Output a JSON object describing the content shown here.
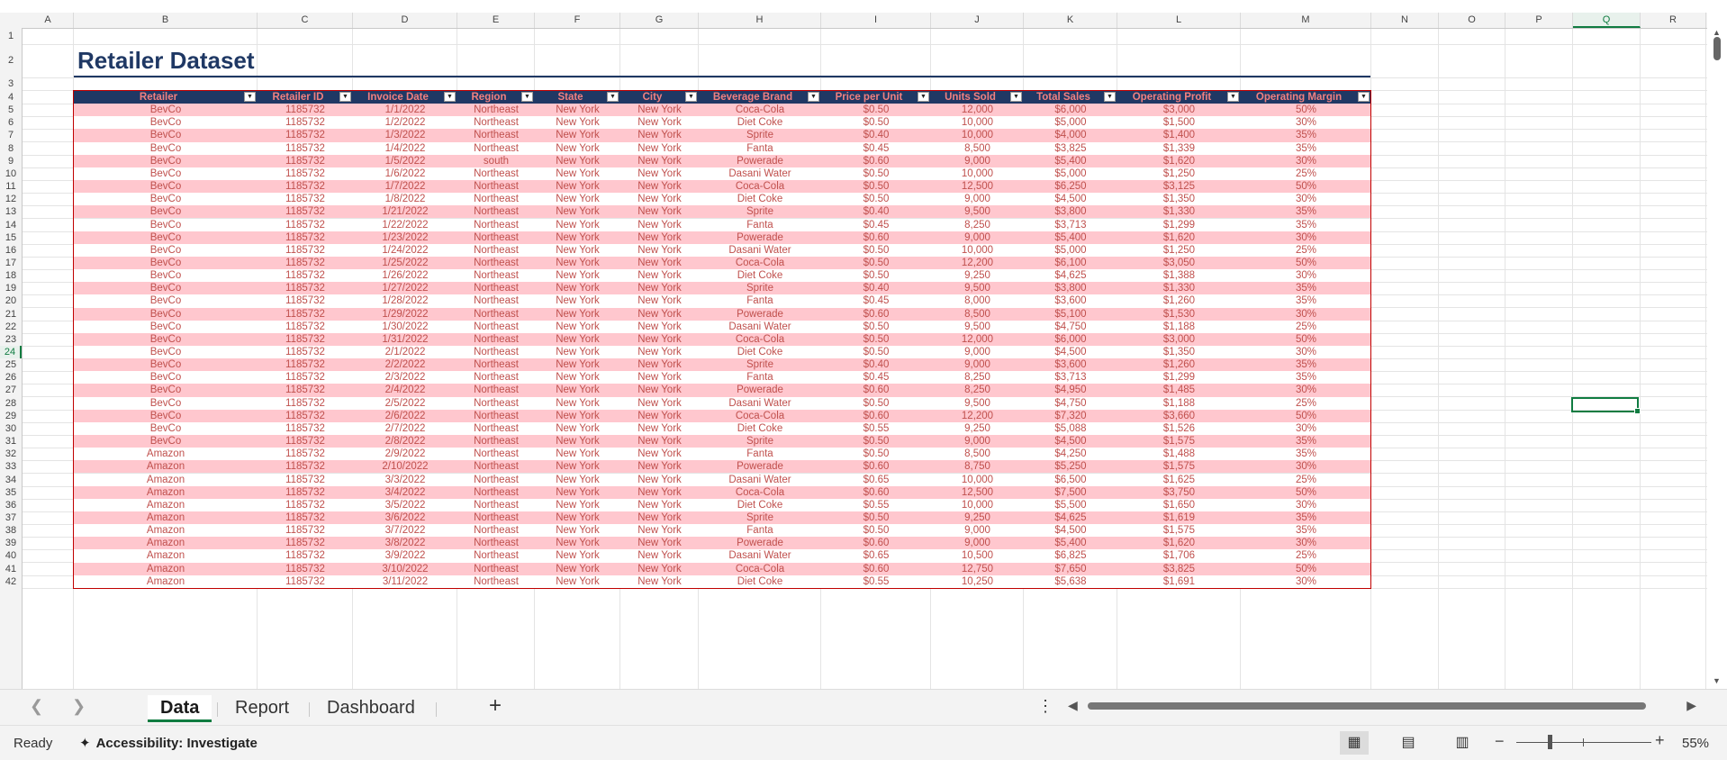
{
  "columns": [
    "A",
    "B",
    "C",
    "D",
    "E",
    "F",
    "G",
    "H",
    "I",
    "J",
    "K",
    "L",
    "M",
    "N",
    "O",
    "P",
    "Q",
    "R"
  ],
  "active_column": "Q",
  "rows": [
    "1",
    "2",
    "3",
    "4",
    "5",
    "6",
    "7",
    "8",
    "9",
    "10",
    "11",
    "12",
    "13",
    "14",
    "15",
    "16",
    "17",
    "18",
    "19",
    "20",
    "21",
    "22",
    "23",
    "24",
    "25",
    "26",
    "27",
    "28",
    "29",
    "30",
    "31",
    "32",
    "33",
    "34",
    "35",
    "36",
    "37",
    "38",
    "39",
    "40",
    "41",
    "42"
  ],
  "active_row": "24",
  "title": "Retailer Dataset",
  "table": {
    "headers": [
      "Retailer",
      "Retailer ID",
      "Invoice Date",
      "Region",
      "State",
      "City",
      "Beverage Brand",
      "Price per Unit",
      "Units Sold",
      "Total Sales",
      "Operating Profit",
      "Operating Margin"
    ],
    "rows": [
      [
        "BevCo",
        "1185732",
        "1/1/2022",
        "Northeast",
        "New York",
        "New York",
        "Coca-Cola",
        "$0.50",
        "12,000",
        "$6,000",
        "$3,000",
        "50%"
      ],
      [
        "BevCo",
        "1185732",
        "1/2/2022",
        "Northeast",
        "New York",
        "New York",
        "Diet Coke",
        "$0.50",
        "10,000",
        "$5,000",
        "$1,500",
        "30%"
      ],
      [
        "BevCo",
        "1185732",
        "1/3/2022",
        "Northeast",
        "New York",
        "New York",
        "Sprite",
        "$0.40",
        "10,000",
        "$4,000",
        "$1,400",
        "35%"
      ],
      [
        "BevCo",
        "1185732",
        "1/4/2022",
        "Northeast",
        "New York",
        "New York",
        "Fanta",
        "$0.45",
        "8,500",
        "$3,825",
        "$1,339",
        "35%"
      ],
      [
        "BevCo",
        "1185732",
        "1/5/2022",
        "south",
        "New York",
        "New York",
        "Powerade",
        "$0.60",
        "9,000",
        "$5,400",
        "$1,620",
        "30%"
      ],
      [
        "BevCo",
        "1185732",
        "1/6/2022",
        "Northeast",
        "New York",
        "New York",
        "Dasani Water",
        "$0.50",
        "10,000",
        "$5,000",
        "$1,250",
        "25%"
      ],
      [
        "BevCo",
        "1185732",
        "1/7/2022",
        "Northeast",
        "New York",
        "New York",
        "Coca-Cola",
        "$0.50",
        "12,500",
        "$6,250",
        "$3,125",
        "50%"
      ],
      [
        "BevCo",
        "1185732",
        "1/8/2022",
        "Northeast",
        "New York",
        "New York",
        "Diet Coke",
        "$0.50",
        "9,000",
        "$4,500",
        "$1,350",
        "30%"
      ],
      [
        "BevCo",
        "1185732",
        "1/21/2022",
        "Northeast",
        "New York",
        "New York",
        "Sprite",
        "$0.40",
        "9,500",
        "$3,800",
        "$1,330",
        "35%"
      ],
      [
        "BevCo",
        "1185732",
        "1/22/2022",
        "Northeast",
        "New York",
        "New York",
        "Fanta",
        "$0.45",
        "8,250",
        "$3,713",
        "$1,299",
        "35%"
      ],
      [
        "BevCo",
        "1185732",
        "1/23/2022",
        "Northeast",
        "New York",
        "New York",
        "Powerade",
        "$0.60",
        "9,000",
        "$5,400",
        "$1,620",
        "30%"
      ],
      [
        "BevCo",
        "1185732",
        "1/24/2022",
        "Northeast",
        "New York",
        "New York",
        "Dasani Water",
        "$0.50",
        "10,000",
        "$5,000",
        "$1,250",
        "25%"
      ],
      [
        "BevCo",
        "1185732",
        "1/25/2022",
        "Northeast",
        "New York",
        "New York",
        "Coca-Cola",
        "$0.50",
        "12,200",
        "$6,100",
        "$3,050",
        "50%"
      ],
      [
        "BevCo",
        "1185732",
        "1/26/2022",
        "Northeast",
        "New York",
        "New York",
        "Diet Coke",
        "$0.50",
        "9,250",
        "$4,625",
        "$1,388",
        "30%"
      ],
      [
        "BevCo",
        "1185732",
        "1/27/2022",
        "Northeast",
        "New York",
        "New York",
        "Sprite",
        "$0.40",
        "9,500",
        "$3,800",
        "$1,330",
        "35%"
      ],
      [
        "BevCo",
        "1185732",
        "1/28/2022",
        "Northeast",
        "New York",
        "New York",
        "Fanta",
        "$0.45",
        "8,000",
        "$3,600",
        "$1,260",
        "35%"
      ],
      [
        "BevCo",
        "1185732",
        "1/29/2022",
        "Northeast",
        "New York",
        "New York",
        "Powerade",
        "$0.60",
        "8,500",
        "$5,100",
        "$1,530",
        "30%"
      ],
      [
        "BevCo",
        "1185732",
        "1/30/2022",
        "Northeast",
        "New York",
        "New York",
        "Dasani Water",
        "$0.50",
        "9,500",
        "$4,750",
        "$1,188",
        "25%"
      ],
      [
        "BevCo",
        "1185732",
        "1/31/2022",
        "Northeast",
        "New York",
        "New York",
        "Coca-Cola",
        "$0.50",
        "12,000",
        "$6,000",
        "$3,000",
        "50%"
      ],
      [
        "BevCo",
        "1185732",
        "2/1/2022",
        "Northeast",
        "New York",
        "New York",
        "Diet Coke",
        "$0.50",
        "9,000",
        "$4,500",
        "$1,350",
        "30%"
      ],
      [
        "BevCo",
        "1185732",
        "2/2/2022",
        "Northeast",
        "New York",
        "New York",
        "Sprite",
        "$0.40",
        "9,000",
        "$3,600",
        "$1,260",
        "35%"
      ],
      [
        "BevCo",
        "1185732",
        "2/3/2022",
        "Northeast",
        "New York",
        "New York",
        "Fanta",
        "$0.45",
        "8,250",
        "$3,713",
        "$1,299",
        "35%"
      ],
      [
        "BevCo",
        "1185732",
        "2/4/2022",
        "Northeast",
        "New York",
        "New York",
        "Powerade",
        "$0.60",
        "8,250",
        "$4,950",
        "$1,485",
        "30%"
      ],
      [
        "BevCo",
        "1185732",
        "2/5/2022",
        "Northeast",
        "New York",
        "New York",
        "Dasani Water",
        "$0.50",
        "9,500",
        "$4,750",
        "$1,188",
        "25%"
      ],
      [
        "BevCo",
        "1185732",
        "2/6/2022",
        "Northeast",
        "New York",
        "New York",
        "Coca-Cola",
        "$0.60",
        "12,200",
        "$7,320",
        "$3,660",
        "50%"
      ],
      [
        "BevCo",
        "1185732",
        "2/7/2022",
        "Northeast",
        "New York",
        "New York",
        "Diet Coke",
        "$0.55",
        "9,250",
        "$5,088",
        "$1,526",
        "30%"
      ],
      [
        "BevCo",
        "1185732",
        "2/8/2022",
        "Northeast",
        "New York",
        "New York",
        "Sprite",
        "$0.50",
        "9,000",
        "$4,500",
        "$1,575",
        "35%"
      ],
      [
        "Amazon",
        "1185732",
        "2/9/2022",
        "Northeast",
        "New York",
        "New York",
        "Fanta",
        "$0.50",
        "8,500",
        "$4,250",
        "$1,488",
        "35%"
      ],
      [
        "Amazon",
        "1185732",
        "2/10/2022",
        "Northeast",
        "New York",
        "New York",
        "Powerade",
        "$0.60",
        "8,750",
        "$5,250",
        "$1,575",
        "30%"
      ],
      [
        "Amazon",
        "1185732",
        "3/3/2022",
        "Northeast",
        "New York",
        "New York",
        "Dasani Water",
        "$0.65",
        "10,000",
        "$6,500",
        "$1,625",
        "25%"
      ],
      [
        "Amazon",
        "1185732",
        "3/4/2022",
        "Northeast",
        "New York",
        "New York",
        "Coca-Cola",
        "$0.60",
        "12,500",
        "$7,500",
        "$3,750",
        "50%"
      ],
      [
        "Amazon",
        "1185732",
        "3/5/2022",
        "Northeast",
        "New York",
        "New York",
        "Diet Coke",
        "$0.55",
        "10,000",
        "$5,500",
        "$1,650",
        "30%"
      ],
      [
        "Amazon",
        "1185732",
        "3/6/2022",
        "Northeast",
        "New York",
        "New York",
        "Sprite",
        "$0.50",
        "9,250",
        "$4,625",
        "$1,619",
        "35%"
      ],
      [
        "Amazon",
        "1185732",
        "3/7/2022",
        "Northeast",
        "New York",
        "New York",
        "Fanta",
        "$0.50",
        "9,000",
        "$4,500",
        "$1,575",
        "35%"
      ],
      [
        "Amazon",
        "1185732",
        "3/8/2022",
        "Northeast",
        "New York",
        "New York",
        "Powerade",
        "$0.60",
        "9,000",
        "$5,400",
        "$1,620",
        "30%"
      ],
      [
        "Amazon",
        "1185732",
        "3/9/2022",
        "Northeast",
        "New York",
        "New York",
        "Dasani Water",
        "$0.65",
        "10,500",
        "$6,825",
        "$1,706",
        "25%"
      ],
      [
        "Amazon",
        "1185732",
        "3/10/2022",
        "Northeast",
        "New York",
        "New York",
        "Coca-Cola",
        "$0.60",
        "12,750",
        "$7,650",
        "$3,825",
        "50%"
      ],
      [
        "Amazon",
        "1185732",
        "3/11/2022",
        "Northeast",
        "New York",
        "New York",
        "Diet Coke",
        "$0.55",
        "10,250",
        "$5,638",
        "$1,691",
        "30%"
      ]
    ]
  },
  "sheet_tabs": [
    {
      "label": "Data",
      "active": true
    },
    {
      "label": "Report",
      "active": false
    },
    {
      "label": "Dashboard",
      "active": false
    }
  ],
  "status": {
    "ready": "Ready",
    "accessibility": "Accessibility: Investigate",
    "zoom": "55%"
  },
  "colors": {
    "header_bg": "#203864",
    "header_text": "#f08080",
    "band": "#ffc7ce",
    "cell_text": "#c0504d",
    "accent": "#107c41"
  }
}
